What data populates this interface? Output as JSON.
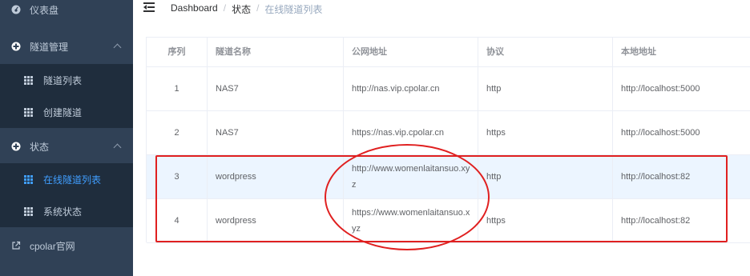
{
  "sidebar": {
    "items": [
      {
        "label": "仪表盘",
        "icon": "dashboard-icon"
      },
      {
        "label": "隧道管理",
        "icon": "plus-circle-icon"
      },
      {
        "label": "隧道列表",
        "icon": "grid-icon"
      },
      {
        "label": "创建隧道",
        "icon": "grid-icon"
      },
      {
        "label": "状态",
        "icon": "plus-circle-icon"
      },
      {
        "label": "在线隧道列表",
        "icon": "grid-icon"
      },
      {
        "label": "系统状态",
        "icon": "grid-icon"
      },
      {
        "label": "cpolar官网",
        "icon": "external-link-icon"
      }
    ],
    "colors": {
      "background": "#304156",
      "submenu": "#1f2d3d",
      "active": "#409eff"
    }
  },
  "breadcrumb": {
    "items": [
      "Dashboard",
      "状态",
      "在线隧道列表"
    ],
    "separator": "/"
  },
  "table": {
    "headers": [
      "序列",
      "隧道名称",
      "公网地址",
      "协议",
      "本地地址"
    ],
    "rows": [
      {
        "index": "1",
        "name": "NAS7",
        "public_line1": "http://nas.vip.cpolar.cn",
        "public_line2": "",
        "protocol": "http",
        "local": "http://localhost:5000"
      },
      {
        "index": "2",
        "name": "NAS7",
        "public_line1": "https://nas.vip.cpolar.cn",
        "public_line2": "",
        "protocol": "https",
        "local": "http://localhost:5000"
      },
      {
        "index": "3",
        "name": "wordpress",
        "public_line1": "http://www.womenlaitansuo.xy",
        "public_line2": "z",
        "protocol": "http",
        "local": "http://localhost:82"
      },
      {
        "index": "4",
        "name": "wordpress",
        "public_line1": "https://www.womenlaitansuo.x",
        "public_line2": "yz",
        "protocol": "https",
        "local": "http://localhost:82"
      }
    ],
    "highlight_color": "#ecf5ff"
  },
  "annotation_color": "#e02020"
}
